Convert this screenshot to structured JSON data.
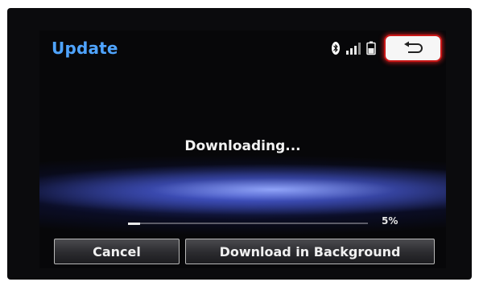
{
  "header": {
    "title": "Update",
    "status_icons": [
      "bluetooth-icon",
      "signal-strength-icon",
      "battery-icon"
    ],
    "back_icon": "return-arrow-icon"
  },
  "main": {
    "message": "Downloading...",
    "progress": {
      "fraction": 0.05,
      "label": "5%"
    }
  },
  "buttons": {
    "cancel_label": "Cancel",
    "background_label": "Download in Background"
  },
  "colors": {
    "title": "#4fa4ff",
    "back_highlight": "#c91717",
    "glow": "#6070ff"
  }
}
